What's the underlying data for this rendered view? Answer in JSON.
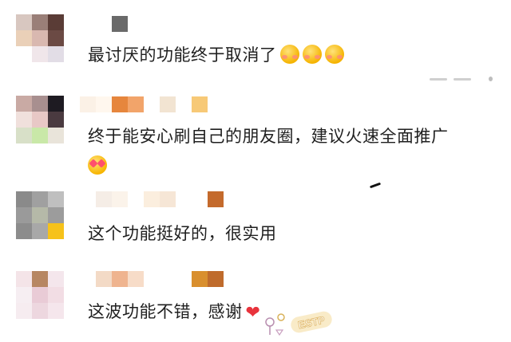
{
  "comments": [
    {
      "text": "最讨厌的功能终于取消了",
      "emojis": [
        "flushed-face-emoji",
        "flushed-face-emoji",
        "flushed-face-emoji"
      ]
    },
    {
      "text_line1": "终于能安心刷自己的朋友圈，建议火速全面推广",
      "emojis": [
        "heart-eyes-emoji"
      ]
    },
    {
      "text": "这个功能挺好的，很实用"
    },
    {
      "text": "这波功能不错，感谢",
      "emojis": [
        "red-heart-emoji"
      ]
    }
  ],
  "watermark": {
    "logo_text": "ESTP"
  },
  "colors": {
    "heart": "#e8333c",
    "emoji_yellow": "#f5b300",
    "text": "#1f1f1f"
  }
}
